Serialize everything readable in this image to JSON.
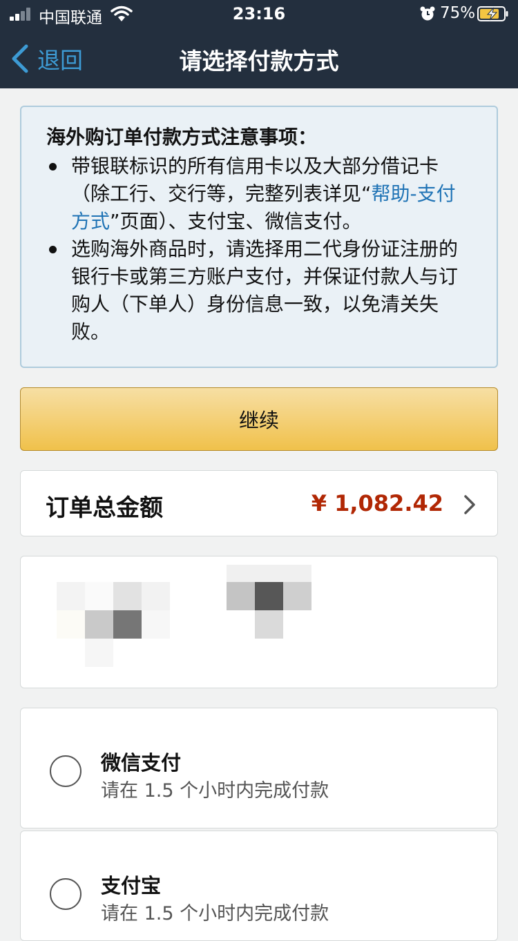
{
  "status_bar": {
    "carrier": "中国联通",
    "time": "23:16",
    "battery": "75%"
  },
  "nav": {
    "back_label": "退回",
    "title": "请选择付款方式"
  },
  "notice": {
    "title": "海外购订单付款方式注意事项：",
    "item1_text": "带银联标识的所有信用卡以及大部分借记卡（除工行、交行等，完整列表详见“",
    "item1_link": "帮助-支付方式",
    "item1_tail": "”页面）、支付宝、微信支付。",
    "item2_text": "选购海外商品时，请选择用二代身份证注册的银行卡或第三方账户支付，并保证付款人与订购人（下单人）身份信息一致，以免清关失败。"
  },
  "continue_label": "继续",
  "order_total": {
    "label": "订单总金额",
    "amount": "¥ 1,082.42"
  },
  "payment_methods": [
    {
      "name": "微信支付",
      "note": "请在 1.5 个小时内完成付款",
      "selected": false
    },
    {
      "name": "支付宝",
      "note": "请在 1.5 个小时内完成付款",
      "selected": false
    }
  ],
  "colors": {
    "header_bg": "#232f3e",
    "link": "#1f73b5",
    "back_link": "#3d9bd4",
    "button_yellow": "#f0c14b",
    "price_red": "#b12704",
    "notice_bg": "#eaf1f6"
  }
}
